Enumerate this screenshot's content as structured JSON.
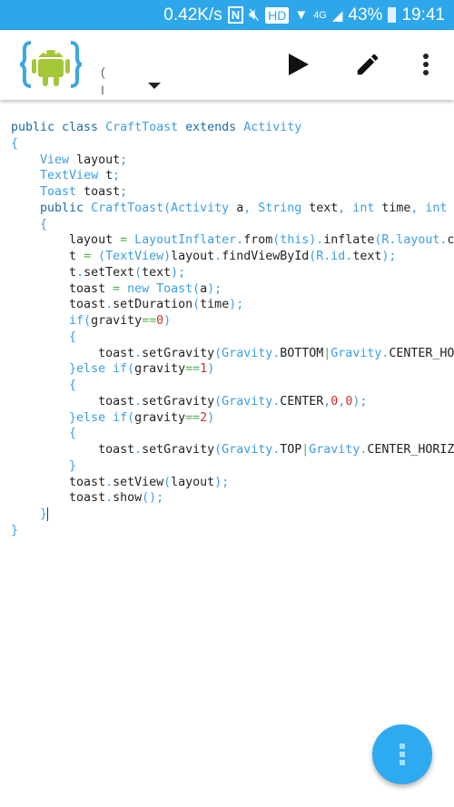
{
  "status_bar": {
    "speed": "0.42K/s",
    "nfc": "N",
    "hd": "HD",
    "network": "4G",
    "battery": "43%",
    "time": "19:41"
  },
  "app_bar": {
    "title_fragment_1": "(",
    "title_fragment_2": "I",
    "icons": [
      "app-logo",
      "dropdown-arrow",
      "run-icon",
      "edit-icon",
      "more-vert-icon"
    ]
  },
  "colors": {
    "accent": "#2ea7ea",
    "keyword": "#1f6aa5",
    "type": "#3a9ee4",
    "operator": "#4caf50",
    "number": "#d32f2f"
  },
  "editor": {
    "current_line": 24,
    "lines": [
      [
        [
          "k",
          "public class "
        ],
        [
          "t",
          "CraftToast "
        ],
        [
          "k",
          "extends "
        ],
        [
          "t",
          "Activity"
        ]
      ],
      [
        [
          "t",
          "{"
        ]
      ],
      [
        [
          "p",
          "    "
        ],
        [
          "t",
          "View "
        ],
        [
          "p",
          "layout"
        ],
        [
          "t",
          ";"
        ]
      ],
      [
        [
          "p",
          "    "
        ],
        [
          "t",
          "TextView "
        ],
        [
          "p",
          "t"
        ],
        [
          "t",
          ";"
        ]
      ],
      [
        [
          "p",
          "    "
        ],
        [
          "t",
          "Toast "
        ],
        [
          "p",
          "toast"
        ],
        [
          "t",
          ";"
        ]
      ],
      [
        [
          "p",
          "    "
        ],
        [
          "k",
          "public "
        ],
        [
          "t",
          "CraftToast(Activity "
        ],
        [
          "p",
          "a"
        ],
        [
          "t",
          ", String "
        ],
        [
          "p",
          "text"
        ],
        [
          "t",
          ", int "
        ],
        [
          "p",
          "time"
        ],
        [
          "t",
          ", int "
        ]
      ],
      [
        [
          "p",
          "    "
        ],
        [
          "t",
          "{"
        ]
      ],
      [
        [
          "p",
          "        layout "
        ],
        [
          "o",
          "= "
        ],
        [
          "t",
          "LayoutInflater."
        ],
        [
          "p",
          "from"
        ],
        [
          "t",
          "(this)."
        ],
        [
          "p",
          "inflate"
        ],
        [
          "t",
          "(R.layout."
        ],
        [
          "p",
          "c"
        ]
      ],
      [
        [
          "p",
          "        t "
        ],
        [
          "o",
          "= "
        ],
        [
          "t",
          "(TextView)"
        ],
        [
          "p",
          "layout"
        ],
        [
          "t",
          "."
        ],
        [
          "p",
          "findViewById"
        ],
        [
          "t",
          "(R.id."
        ],
        [
          "p",
          "text"
        ],
        [
          "t",
          ");"
        ]
      ],
      [
        [
          "p",
          "        t"
        ],
        [
          "t",
          "."
        ],
        [
          "p",
          "setText"
        ],
        [
          "t",
          "("
        ],
        [
          "p",
          "text"
        ],
        [
          "t",
          ");"
        ]
      ],
      [
        [
          "p",
          "        toast "
        ],
        [
          "o",
          "= "
        ],
        [
          "t",
          "new Toast("
        ],
        [
          "p",
          "a"
        ],
        [
          "t",
          ");"
        ]
      ],
      [
        [
          "p",
          "        toast"
        ],
        [
          "t",
          "."
        ],
        [
          "p",
          "setDuration"
        ],
        [
          "t",
          "("
        ],
        [
          "p",
          "time"
        ],
        [
          "t",
          ");"
        ]
      ],
      [
        [
          "p",
          "        "
        ],
        [
          "t",
          "if("
        ],
        [
          "p",
          "gravity"
        ],
        [
          "o",
          "=="
        ],
        [
          "n",
          "0"
        ],
        [
          "t",
          ")"
        ]
      ],
      [
        [
          "p",
          "        "
        ],
        [
          "t",
          "{"
        ]
      ],
      [
        [
          "p",
          "            toast"
        ],
        [
          "t",
          "."
        ],
        [
          "p",
          "setGravity"
        ],
        [
          "t",
          "(Gravity."
        ],
        [
          "p",
          "BOTTOM"
        ],
        [
          "o",
          "|"
        ],
        [
          "t",
          "Gravity."
        ],
        [
          "p",
          "CENTER_HO"
        ]
      ],
      [
        [
          "p",
          "        "
        ],
        [
          "t",
          "}else if("
        ],
        [
          "p",
          "gravity"
        ],
        [
          "o",
          "=="
        ],
        [
          "n",
          "1"
        ],
        [
          "t",
          ")"
        ]
      ],
      [
        [
          "p",
          "        "
        ],
        [
          "t",
          "{"
        ]
      ],
      [
        [
          "p",
          "            toast"
        ],
        [
          "t",
          "."
        ],
        [
          "p",
          "setGravity"
        ],
        [
          "t",
          "(Gravity."
        ],
        [
          "p",
          "CENTER"
        ],
        [
          "t",
          ","
        ],
        [
          "n",
          "0"
        ],
        [
          "t",
          ","
        ],
        [
          "n",
          "0"
        ],
        [
          "t",
          ");"
        ]
      ],
      [
        [
          "p",
          "        "
        ],
        [
          "t",
          "}else if("
        ],
        [
          "p",
          "gravity"
        ],
        [
          "o",
          "=="
        ],
        [
          "n",
          "2"
        ],
        [
          "t",
          ")"
        ]
      ],
      [
        [
          "p",
          "        "
        ],
        [
          "t",
          "{"
        ]
      ],
      [
        [
          "p",
          "            toast"
        ],
        [
          "t",
          "."
        ],
        [
          "p",
          "setGravity"
        ],
        [
          "t",
          "(Gravity."
        ],
        [
          "p",
          "TOP"
        ],
        [
          "o",
          "|"
        ],
        [
          "t",
          "Gravity."
        ],
        [
          "p",
          "CENTER_HORIZ"
        ]
      ],
      [
        [
          "p",
          "        "
        ],
        [
          "t",
          "}"
        ]
      ],
      [
        [
          "p",
          "        toast"
        ],
        [
          "t",
          "."
        ],
        [
          "p",
          "setView"
        ],
        [
          "t",
          "("
        ],
        [
          "p",
          "layout"
        ],
        [
          "t",
          ");"
        ]
      ],
      [
        [
          "p",
          "        toast"
        ],
        [
          "t",
          "."
        ],
        [
          "p",
          "show"
        ],
        [
          "t",
          "();"
        ]
      ],
      [
        [
          "p",
          "    "
        ],
        [
          "t",
          "}"
        ]
      ],
      [
        [
          "t",
          "}"
        ]
      ]
    ]
  },
  "fab": {
    "icon": "more-vert-icon"
  }
}
